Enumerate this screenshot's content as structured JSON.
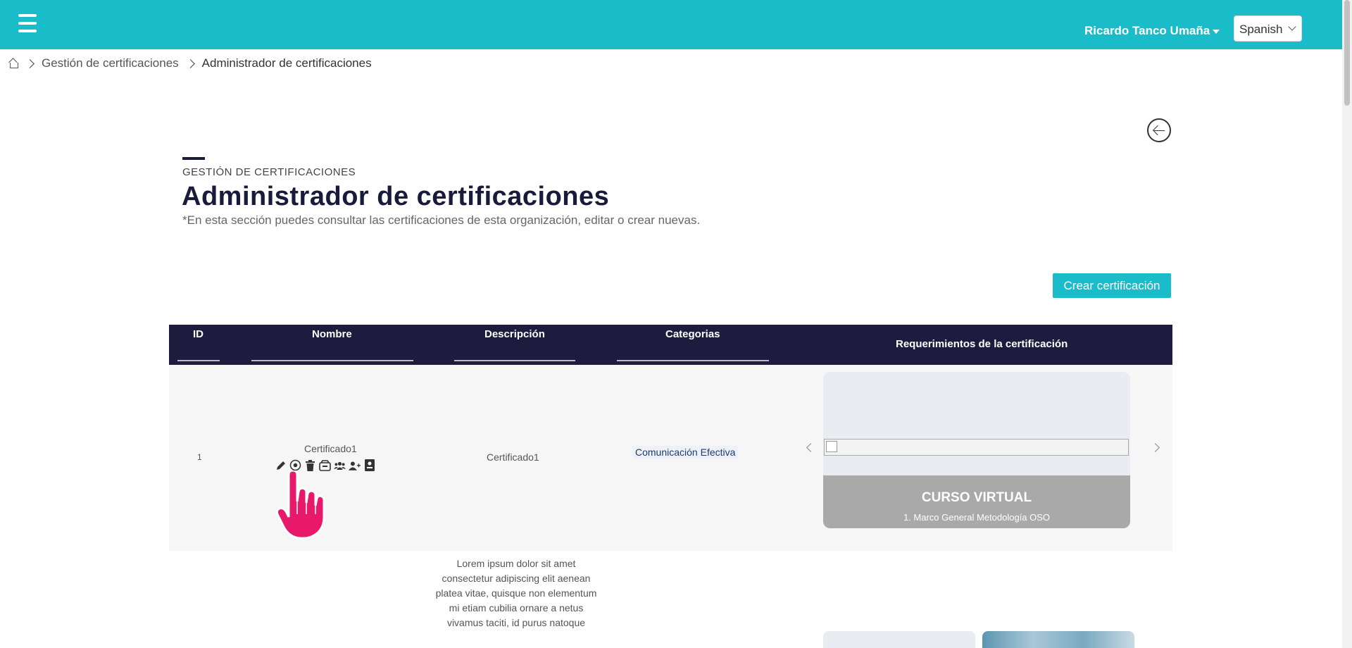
{
  "topbar": {
    "user_name": "Ricardo Tanco Umaña",
    "language": "Spanish"
  },
  "breadcrumb": {
    "items": [
      "Gestión de certificaciones",
      "Administrador de certificaciones"
    ]
  },
  "header": {
    "eyebrow": "GESTIÓN DE CERTIFICACIONES",
    "title": "Administrador de certificaciones",
    "subtitle": "*En esta sección puedes consultar las certificaciones de esta organización, editar o crear nuevas."
  },
  "create_button": "Crear certificación",
  "table": {
    "columns": [
      "ID",
      "Nombre",
      "Descripción",
      "Categorias",
      "Requerimientos de la certificación"
    ],
    "rows": [
      {
        "id": "1",
        "name": "Certificado1",
        "description": "Certificado1",
        "category": "Comunicación Efectiva",
        "card_title": "CURSO VIRTUAL",
        "card_subtitle": "1. Marco General Metodología OSO"
      }
    ],
    "next_description": "Lorem ipsum dolor sit amet consectetur adipiscing elit aenean platea vitae, quisque non elementum mi etiam cubilia ornare a netus vivamus taciti, id purus natoque"
  },
  "icons": [
    "menu-icon",
    "home-icon",
    "back-arrow-icon",
    "edit-icon",
    "view-icon",
    "delete-icon",
    "archive-icon",
    "group-icon",
    "add-user-icon",
    "certificate-icon",
    "hand-cursor-icon"
  ],
  "colors": {
    "topbar": "#1bbcca",
    "table_header": "#1d1c3f",
    "title": "#1a1b3a",
    "cursor": "#e8196b"
  }
}
